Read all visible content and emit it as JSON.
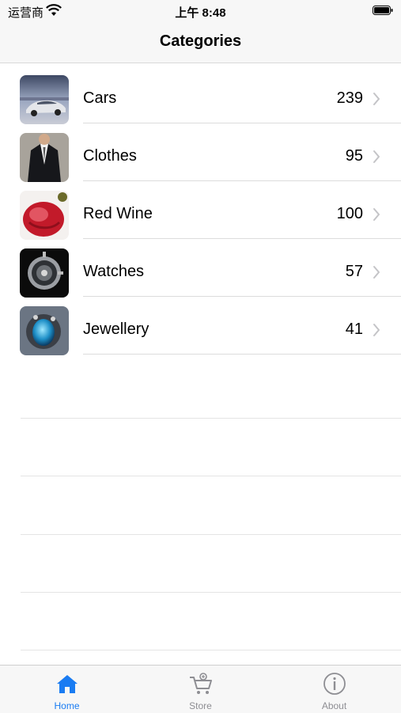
{
  "status": {
    "carrier": "运营商",
    "time": "上午 8:48",
    "icons": [
      "wifi-icon",
      "battery-icon"
    ]
  },
  "nav": {
    "title": "Categories"
  },
  "categories": [
    {
      "label": "Cars",
      "count": "239",
      "icon": "car-thumbnail"
    },
    {
      "label": "Clothes",
      "count": "95",
      "icon": "suit-thumbnail"
    },
    {
      "label": "Red Wine",
      "count": "100",
      "icon": "wine-thumbnail"
    },
    {
      "label": "Watches",
      "count": "57",
      "icon": "watch-thumbnail"
    },
    {
      "label": "Jewellery",
      "count": "41",
      "icon": "jewel-thumbnail"
    }
  ],
  "tabs": [
    {
      "label": "Home",
      "icon": "home-icon",
      "selected": true
    },
    {
      "label": "Store",
      "icon": "cart-icon",
      "selected": false
    },
    {
      "label": "About",
      "icon": "info-icon",
      "selected": false
    }
  ],
  "colors": {
    "accent": "#1a7cf2",
    "inactive": "#8e8e93",
    "bar_background": "#f7f7f7",
    "separator": "#dcdcdc"
  }
}
